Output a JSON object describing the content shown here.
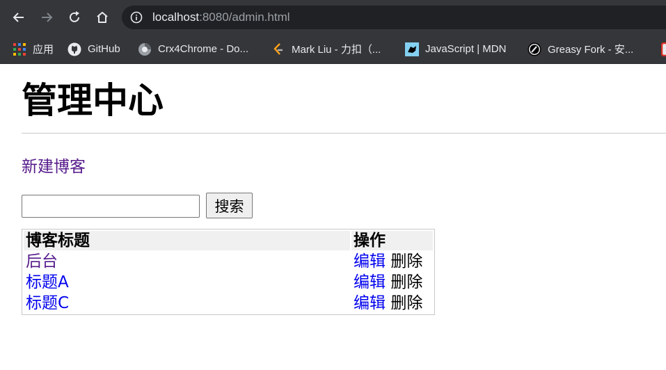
{
  "browser": {
    "url_host": "localhost",
    "url_path": ":8080/admin.html",
    "bookmarks": [
      {
        "label": "应用",
        "icon": "apps-grid-icon"
      },
      {
        "label": "GitHub",
        "icon": "github-icon"
      },
      {
        "label": "Crx4Chrome - Do...",
        "icon": "crx4chrome-icon"
      },
      {
        "label": "Mark Liu - 力扣（...",
        "icon": "leetcode-icon"
      },
      {
        "label": "JavaScript | MDN",
        "icon": "mdn-icon"
      },
      {
        "label": "Greasy Fork - 安...",
        "icon": "greasyfork-icon"
      }
    ]
  },
  "page": {
    "title": "管理中心",
    "new_blog_link": "新建博客",
    "search": {
      "value": "",
      "placeholder": "",
      "button_label": "搜索"
    },
    "table": {
      "headers": {
        "title": "博客标题",
        "actions": "操作"
      },
      "rows": [
        {
          "title": "后台",
          "title_visited": true,
          "edit": "编辑",
          "delete": "删除"
        },
        {
          "title": "标题A",
          "title_visited": false,
          "edit": "编辑",
          "delete": "删除"
        },
        {
          "title": "标题C",
          "title_visited": false,
          "edit": "编辑",
          "delete": "删除"
        }
      ]
    }
  },
  "colors": {
    "chrome_bg": "#35363a",
    "omnibox_bg": "#202124",
    "visited_link": "#551a8b",
    "link": "#0000ee"
  }
}
